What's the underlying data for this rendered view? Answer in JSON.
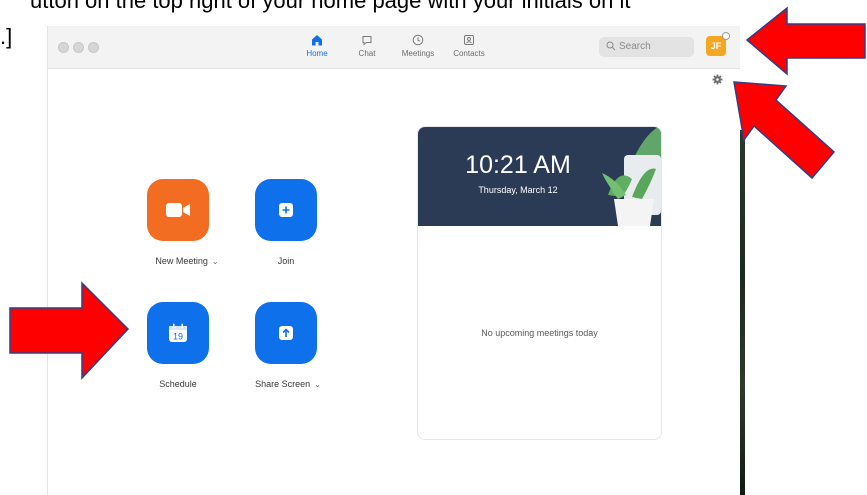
{
  "instruction_text": {
    "line1": "utton on the top right of your home page with your initials on it",
    "line2": ".]"
  },
  "titlebar": {
    "nav": [
      {
        "label": "Home",
        "icon": "home-icon",
        "active": true
      },
      {
        "label": "Chat",
        "icon": "chat-icon",
        "active": false
      },
      {
        "label": "Meetings",
        "icon": "clock-icon",
        "active": false
      },
      {
        "label": "Contacts",
        "icon": "contacts-icon",
        "active": false
      }
    ],
    "search_placeholder": "Search",
    "avatar_initials": "JF"
  },
  "actions": [
    {
      "label": "New Meeting",
      "icon": "video-camera-icon",
      "has_dropdown": true,
      "color": "#f26d21"
    },
    {
      "label": "Join",
      "icon": "plus-icon",
      "has_dropdown": false,
      "color": "#0e71eb"
    },
    {
      "label": "Schedule",
      "icon": "calendar-icon",
      "calendar_day": "19",
      "has_dropdown": false,
      "color": "#0e71eb"
    },
    {
      "label": "Share Screen",
      "icon": "share-screen-icon",
      "has_dropdown": true,
      "color": "#0e71eb"
    }
  ],
  "clock_card": {
    "time": "10:21 AM",
    "date": "Thursday, March 12",
    "empty_message": "No upcoming meetings today",
    "header_color": "#2b3b55"
  },
  "annotation_color": "#ff0000"
}
